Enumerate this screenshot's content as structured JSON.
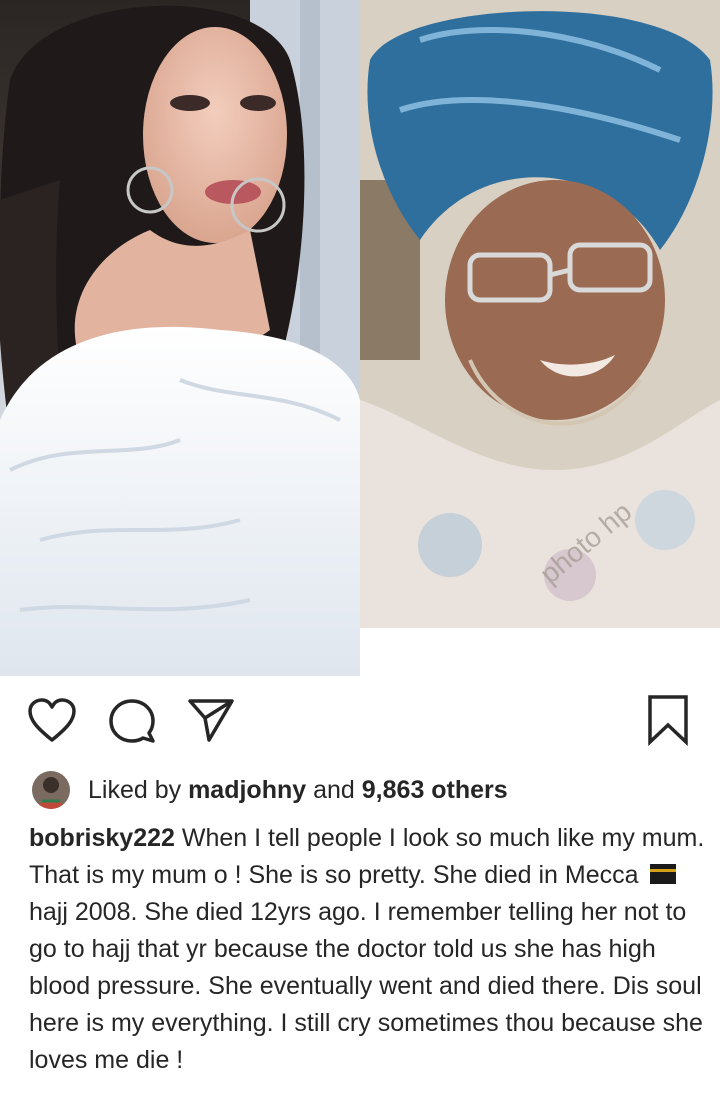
{
  "post": {
    "images": [
      {
        "name": "left-photo",
        "description_icon": "portrait-photo"
      },
      {
        "name": "right-photo",
        "description_icon": "portrait-photo",
        "watermark": "photo hp"
      }
    ],
    "actions": {
      "like_icon": "heart-icon",
      "comment_icon": "comment-icon",
      "share_icon": "send-icon",
      "save_icon": "bookmark-icon"
    },
    "likes": {
      "prefix": "Liked by",
      "user": "madjohny",
      "connector": "and",
      "count": "9,863 others"
    },
    "caption": {
      "username": "bobrisky222",
      "text_before_emoji": " When I tell people I look so much like my mum. That is my mum o ! She is so pretty. She died in Mecca",
      "emoji": "kaaba-icon",
      "text_after_emoji": " hajj 2008. She died 12yrs ago. I remember telling her not to go to hajj that yr because the doctor told us she has high blood pressure. She eventually went and died there. Dis soul here is my everything. I still cry sometimes thou because she loves me die !"
    }
  },
  "colors": {
    "text": "#262626",
    "background": "#ffffff"
  }
}
